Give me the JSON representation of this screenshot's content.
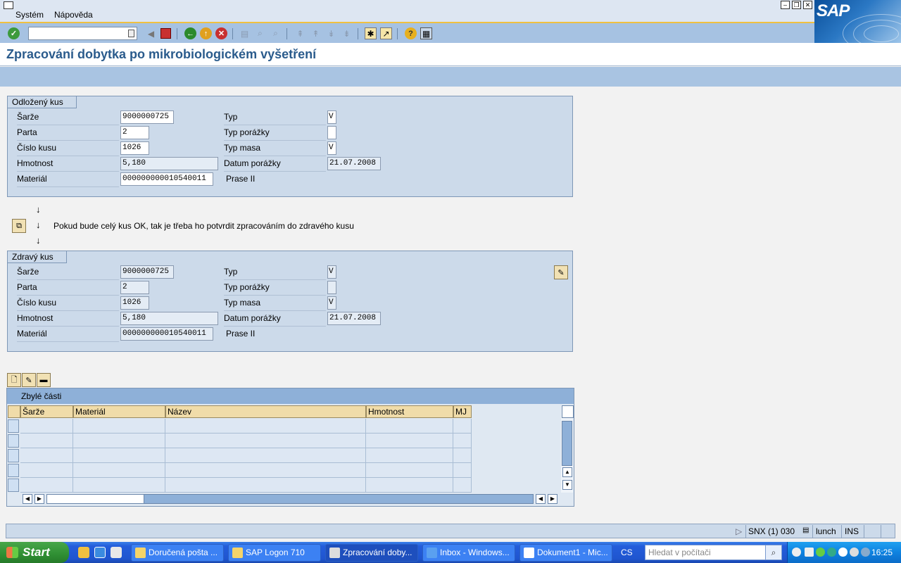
{
  "menu": {
    "items": [
      "Systém",
      "Nápověda"
    ]
  },
  "toolbar": {
    "command_value": ""
  },
  "title": "Zpracování dobytka po mikrobiologickém vyšetření",
  "group1": {
    "title": "Odložený kus",
    "sarze_label": "Šarže",
    "sarze": "9000000725",
    "parta_label": "Parta",
    "parta": "2",
    "cislo_label": "Číslo kusu",
    "cislo": "1026",
    "hmotnost_label": "Hmotnost",
    "hmotnost": "5,180",
    "material_label": "Materiál",
    "material": "000000000010540011",
    "typ_label": "Typ",
    "typ": "V",
    "typ_porazky_label": "Typ porážky",
    "typ_porazky": "",
    "typ_masa_label": "Typ masa",
    "typ_masa": "V",
    "datum_label": "Datum porážky",
    "datum": "21.07.2008",
    "material_text": "Prase II"
  },
  "note": "Pokud bude celý kus OK, tak je třeba ho potvrdit zpracováním do zdravého kusu",
  "group2": {
    "title": "Zdravý kus",
    "sarze_label": "Šarže",
    "sarze": "9000000725",
    "parta_label": "Parta",
    "parta": "2",
    "cislo_label": "Číslo kusu",
    "cislo": "1026",
    "hmotnost_label": "Hmotnost",
    "hmotnost": "5,180",
    "material_label": "Materiál",
    "material": "000000000010540011",
    "typ_label": "Typ",
    "typ": "V",
    "typ_porazky_label": "Typ porážky",
    "typ_porazky": "",
    "typ_masa_label": "Typ masa",
    "typ_masa": "V",
    "datum_label": "Datum porážky",
    "datum": "21.07.2008",
    "material_text": "Prase II"
  },
  "table": {
    "title": "Zbylé části",
    "columns": [
      "Šarže",
      "Materiál",
      "Název",
      "Hmotnost",
      "MJ"
    ]
  },
  "status": {
    "system": "SNX (1) 030",
    "client": "lunch",
    "mode": "INS"
  },
  "taskbar": {
    "start": "Start",
    "tasks": [
      "Doručená pošta ...",
      "SAP Logon 710",
      "Zpracování doby...",
      "Inbox - Windows...",
      "Dokument1 - Mic..."
    ],
    "lang": "CS",
    "search_placeholder": "Hledat v počítači",
    "clock": "16:25"
  }
}
